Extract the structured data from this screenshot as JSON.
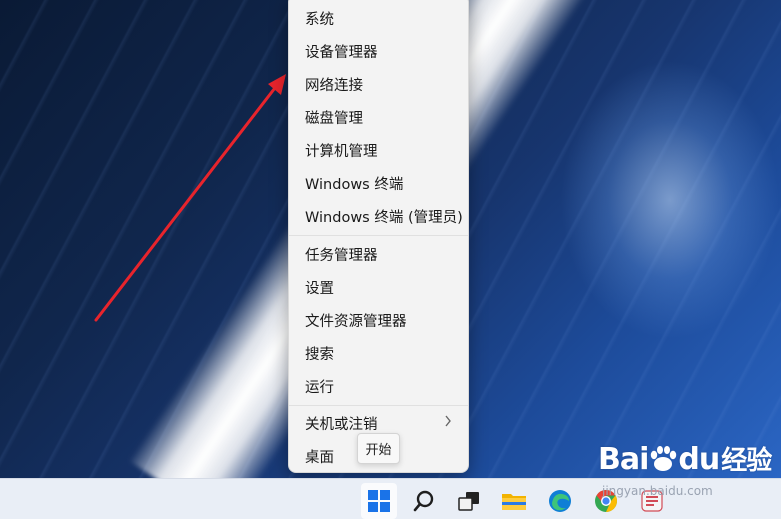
{
  "context_menu": {
    "items": [
      {
        "label": "系统"
      },
      {
        "label": "设备管理器"
      },
      {
        "label": "网络连接"
      },
      {
        "label": "磁盘管理"
      },
      {
        "label": "计算机管理"
      },
      {
        "label": "Windows 终端"
      },
      {
        "label": "Windows 终端 (管理员)"
      },
      {
        "label": "任务管理器"
      },
      {
        "label": "设置"
      },
      {
        "label": "文件资源管理器"
      },
      {
        "label": "搜索"
      },
      {
        "label": "运行"
      },
      {
        "label": "关机或注销",
        "submenu_icon": "chevron-right-icon"
      },
      {
        "label": "桌面"
      }
    ]
  },
  "tooltip": {
    "text": "开始"
  },
  "annotation": {
    "color": "#e8242c",
    "icon": "red-arrow"
  },
  "taskbar": {
    "icons": [
      "windows-start-icon",
      "search-icon",
      "task-view-icon",
      "file-explorer-icon",
      "edge-icon",
      "chrome-icon",
      "app-icon"
    ]
  },
  "watermark": {
    "brand": "Bai",
    "brand_suffix": "du",
    "product": "经验",
    "url": "jingyan.baidu.com"
  },
  "colors": {
    "menu_bg": "#f3f3f3",
    "taskbar_bg": "#e9eef6",
    "start_blue": "#1a73e8"
  }
}
